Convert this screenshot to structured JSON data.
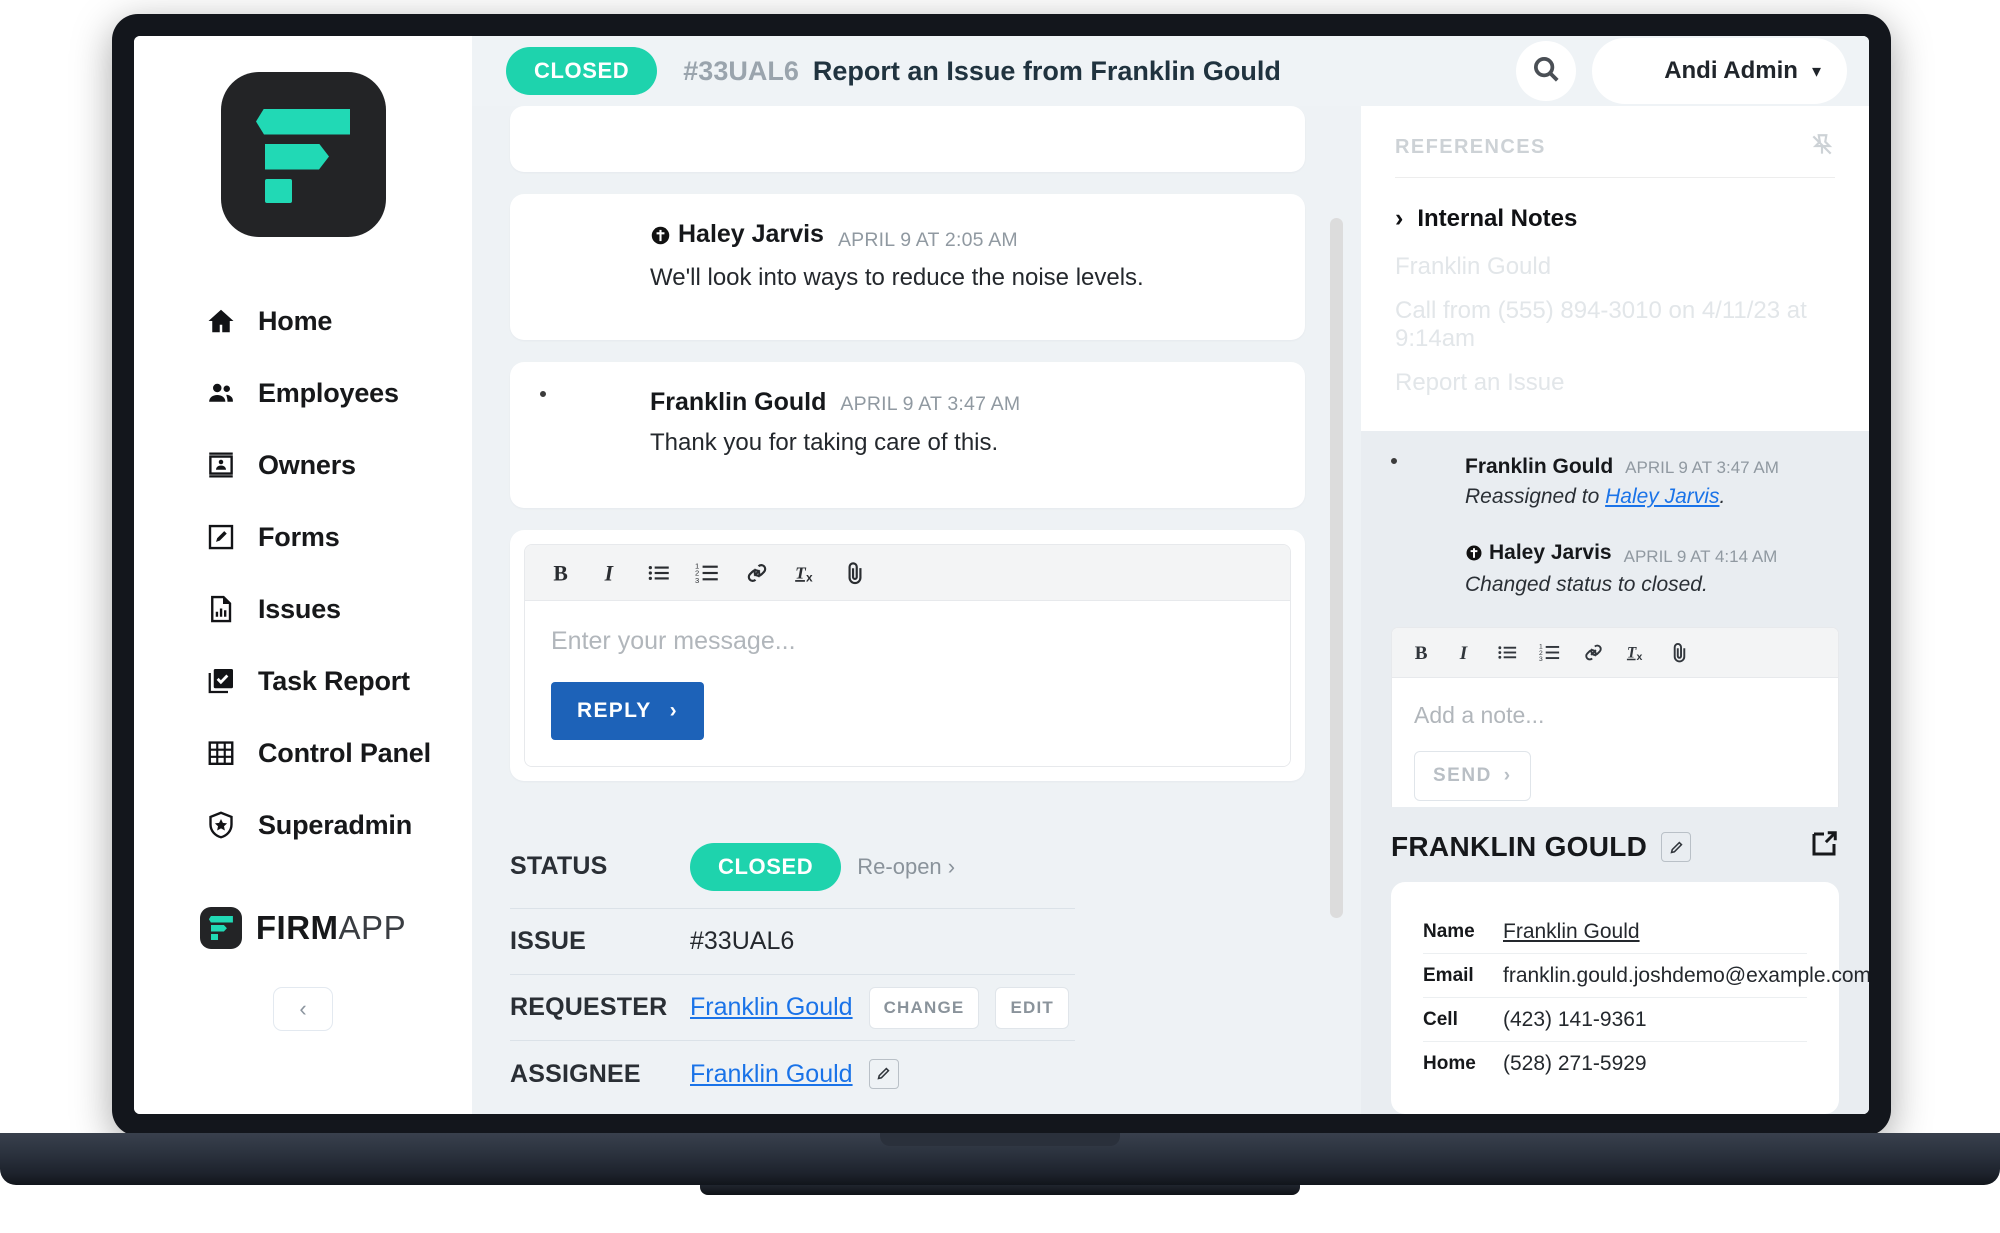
{
  "topbar": {
    "status_pill": "CLOSED",
    "issue_id": "#33UAL6",
    "issue_title": "Report an Issue from Franklin Gould",
    "search_icon": "search-icon",
    "user_name": "Andi Admin",
    "user_caret": "⌄"
  },
  "sidebar": {
    "logo_alt": "firmapp-logo",
    "items": [
      {
        "label": "Home",
        "icon": "home-icon"
      },
      {
        "label": "Employees",
        "icon": "people-icon"
      },
      {
        "label": "Owners",
        "icon": "id-card-icon"
      },
      {
        "label": "Forms",
        "icon": "pencil-square-icon"
      },
      {
        "label": "Issues",
        "icon": "document-chart-icon"
      },
      {
        "label": "Task Report",
        "icon": "checkbox-stack-icon"
      },
      {
        "label": "Control Panel",
        "icon": "grid-icon"
      },
      {
        "label": "Superadmin",
        "icon": "shield-star-icon"
      }
    ],
    "brand_bold": "FIRM",
    "brand_light": "APP",
    "collapse_icon": "chevron-left-icon"
  },
  "thread": {
    "messages": [
      {
        "name": "",
        "time": "",
        "text": "",
        "avatar": "f-male2",
        "is_agent": false,
        "clipped": true
      },
      {
        "name": "Haley Jarvis",
        "time": "APRIL 9 AT 2:05 AM",
        "text": "We'll look into ways to reduce the noise levels.",
        "avatar": "f-female",
        "is_agent": true,
        "clipped": false
      },
      {
        "name": "Franklin Gould",
        "time": "APRIL 9 AT 3:47 AM",
        "text": "Thank you for taking care of this.",
        "avatar": "f-male",
        "is_agent": false,
        "clipped": false
      }
    ],
    "editor": {
      "toolbar": [
        "bold-icon",
        "italic-icon",
        "bulleted-list-icon",
        "numbered-list-icon",
        "link-icon",
        "clear-formatting-icon",
        "attachment-icon"
      ],
      "placeholder": "Enter your message...",
      "submit_label": "REPLY",
      "submit_chevron": "›"
    }
  },
  "details": {
    "status_key": "STATUS",
    "status_value": "CLOSED",
    "status_action": "Re-open ›",
    "issue_key": "ISSUE",
    "issue_value": "#33UAL6",
    "requester_key": "REQUESTER",
    "requester_value": "Franklin Gould",
    "requester_change": "CHANGE",
    "requester_edit": "EDIT",
    "assignee_key": "ASSIGNEE",
    "assignee_value": "Franklin Gould"
  },
  "right_panel": {
    "references_title": "REFERENCES",
    "pin_icon": "pin-off-icon",
    "internal_notes_label": "Internal Notes",
    "internal_notes_chevron": "›",
    "reference_lines": [
      "Franklin Gould",
      "Call from (555) 894-3010 on 4/11/23 at 9:14am",
      "Report an Issue"
    ],
    "notes": [
      {
        "name": "Franklin Gould",
        "time": "APRIL 9 AT 3:47 AM",
        "text_prefix": "Reassigned to ",
        "text_link": "Haley Jarvis",
        "text_suffix": ".",
        "avatar": "f-male",
        "is_agent": false
      },
      {
        "name": "Haley Jarvis",
        "time": "APRIL 9 AT 4:14 AM",
        "text_prefix": "Changed status to closed.",
        "text_link": "",
        "text_suffix": "",
        "avatar": "f-female",
        "is_agent": true
      }
    ],
    "note_editor": {
      "toolbar": [
        "bold-icon",
        "italic-icon",
        "bulleted-list-icon",
        "numbered-list-icon",
        "link-icon",
        "clear-formatting-icon",
        "attachment-icon"
      ],
      "placeholder": "Add a note...",
      "submit_label": "SEND",
      "submit_chevron": "›"
    },
    "contact": {
      "heading": "FRANKLIN GOULD",
      "edit_icon": "pencil-square-icon",
      "open_external_icon": "open-external-icon",
      "rows": [
        {
          "key": "Name",
          "value": "Franklin Gould",
          "is_link": true
        },
        {
          "key": "Email",
          "value": "franklin.gould.joshdemo@example.com",
          "is_link": false
        },
        {
          "key": "Cell",
          "value": "(423) 141-9361",
          "is_link": false
        },
        {
          "key": "Home",
          "value": "(528) 271-5929",
          "is_link": false
        }
      ]
    }
  },
  "colors": {
    "accent_teal": "#1ed3ad",
    "link_blue": "#1a73e8",
    "reply_blue": "#1d62b8",
    "app_bg": "#eef2f5",
    "panel_bg": "#e9edf1"
  }
}
